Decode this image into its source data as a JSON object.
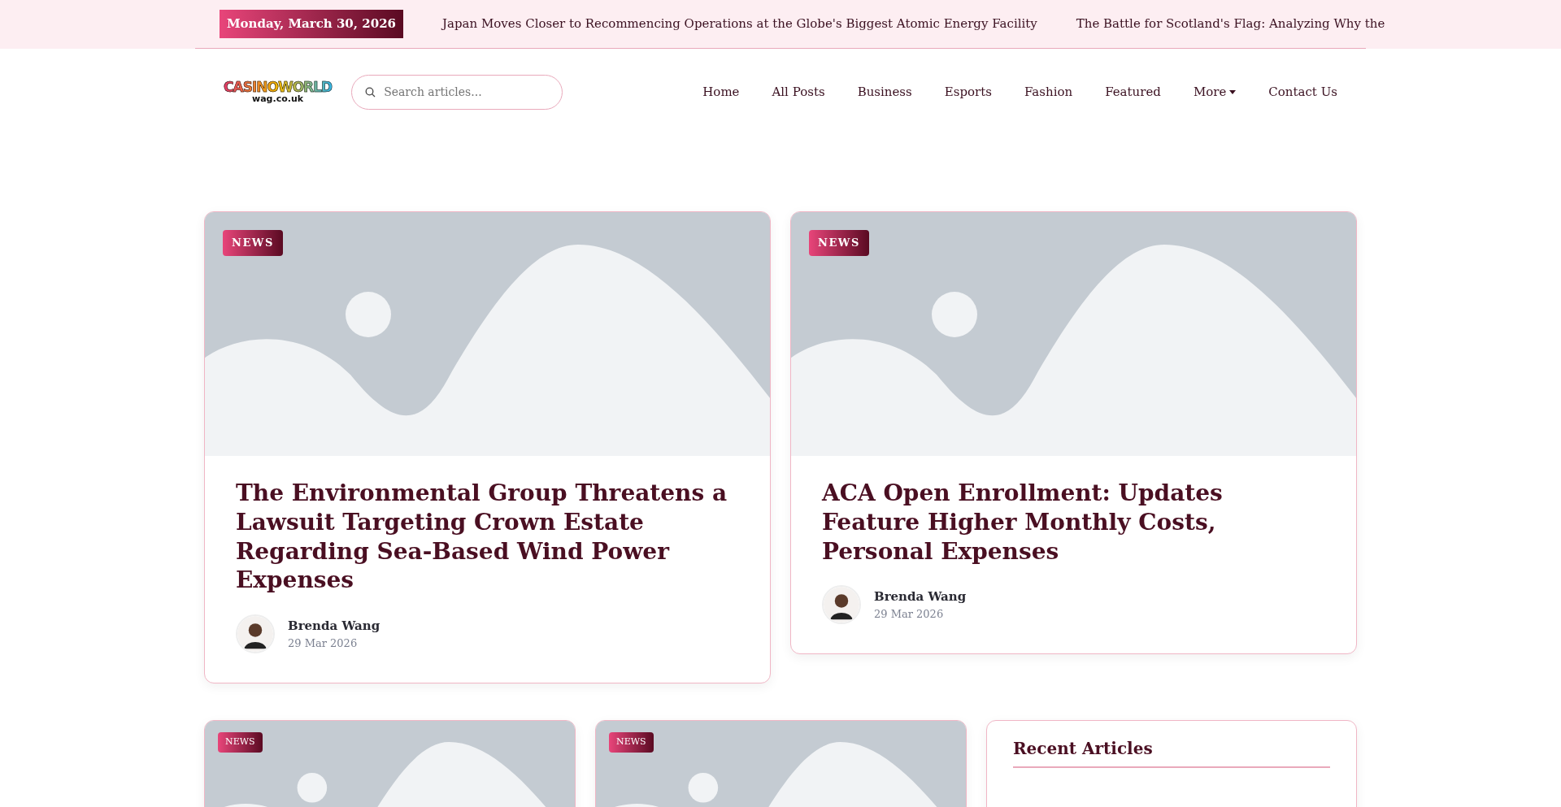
{
  "topbar": {
    "date": "Monday, March 30, 2026",
    "ticker": [
      "Japan Moves Closer to Recommencing Operations at the Globe's Biggest Atomic Energy Facility",
      "The Battle for Scotland's Flag: Analyzing Why the"
    ]
  },
  "logo": {
    "name": "CASINOWORLD",
    "domain": "wag.co.uk"
  },
  "search": {
    "placeholder": "Search articles..."
  },
  "nav": [
    {
      "label": "Home",
      "dropdown": false
    },
    {
      "label": "All Posts",
      "dropdown": false
    },
    {
      "label": "Business",
      "dropdown": false
    },
    {
      "label": "Esports",
      "dropdown": false
    },
    {
      "label": "Fashion",
      "dropdown": false
    },
    {
      "label": "Featured",
      "dropdown": false
    },
    {
      "label": "More",
      "dropdown": true
    },
    {
      "label": "Contact Us",
      "dropdown": false
    }
  ],
  "featured": [
    {
      "category": "NEWS",
      "title": "The Environmental Group Threatens a Lawsuit Targeting Crown Estate Regarding Sea-Based Wind Power Expenses",
      "author": "Brenda Wang",
      "date": "29 Mar 2026"
    },
    {
      "category": "NEWS",
      "title": "ACA Open Enrollment: Updates Feature Higher Monthly Costs, Personal Expenses",
      "author": "Brenda Wang",
      "date": "29 Mar 2026"
    }
  ],
  "grid": [
    {
      "category": "NEWS"
    },
    {
      "category": "NEWS"
    }
  ],
  "sidebar": {
    "title": "Recent Articles"
  }
}
